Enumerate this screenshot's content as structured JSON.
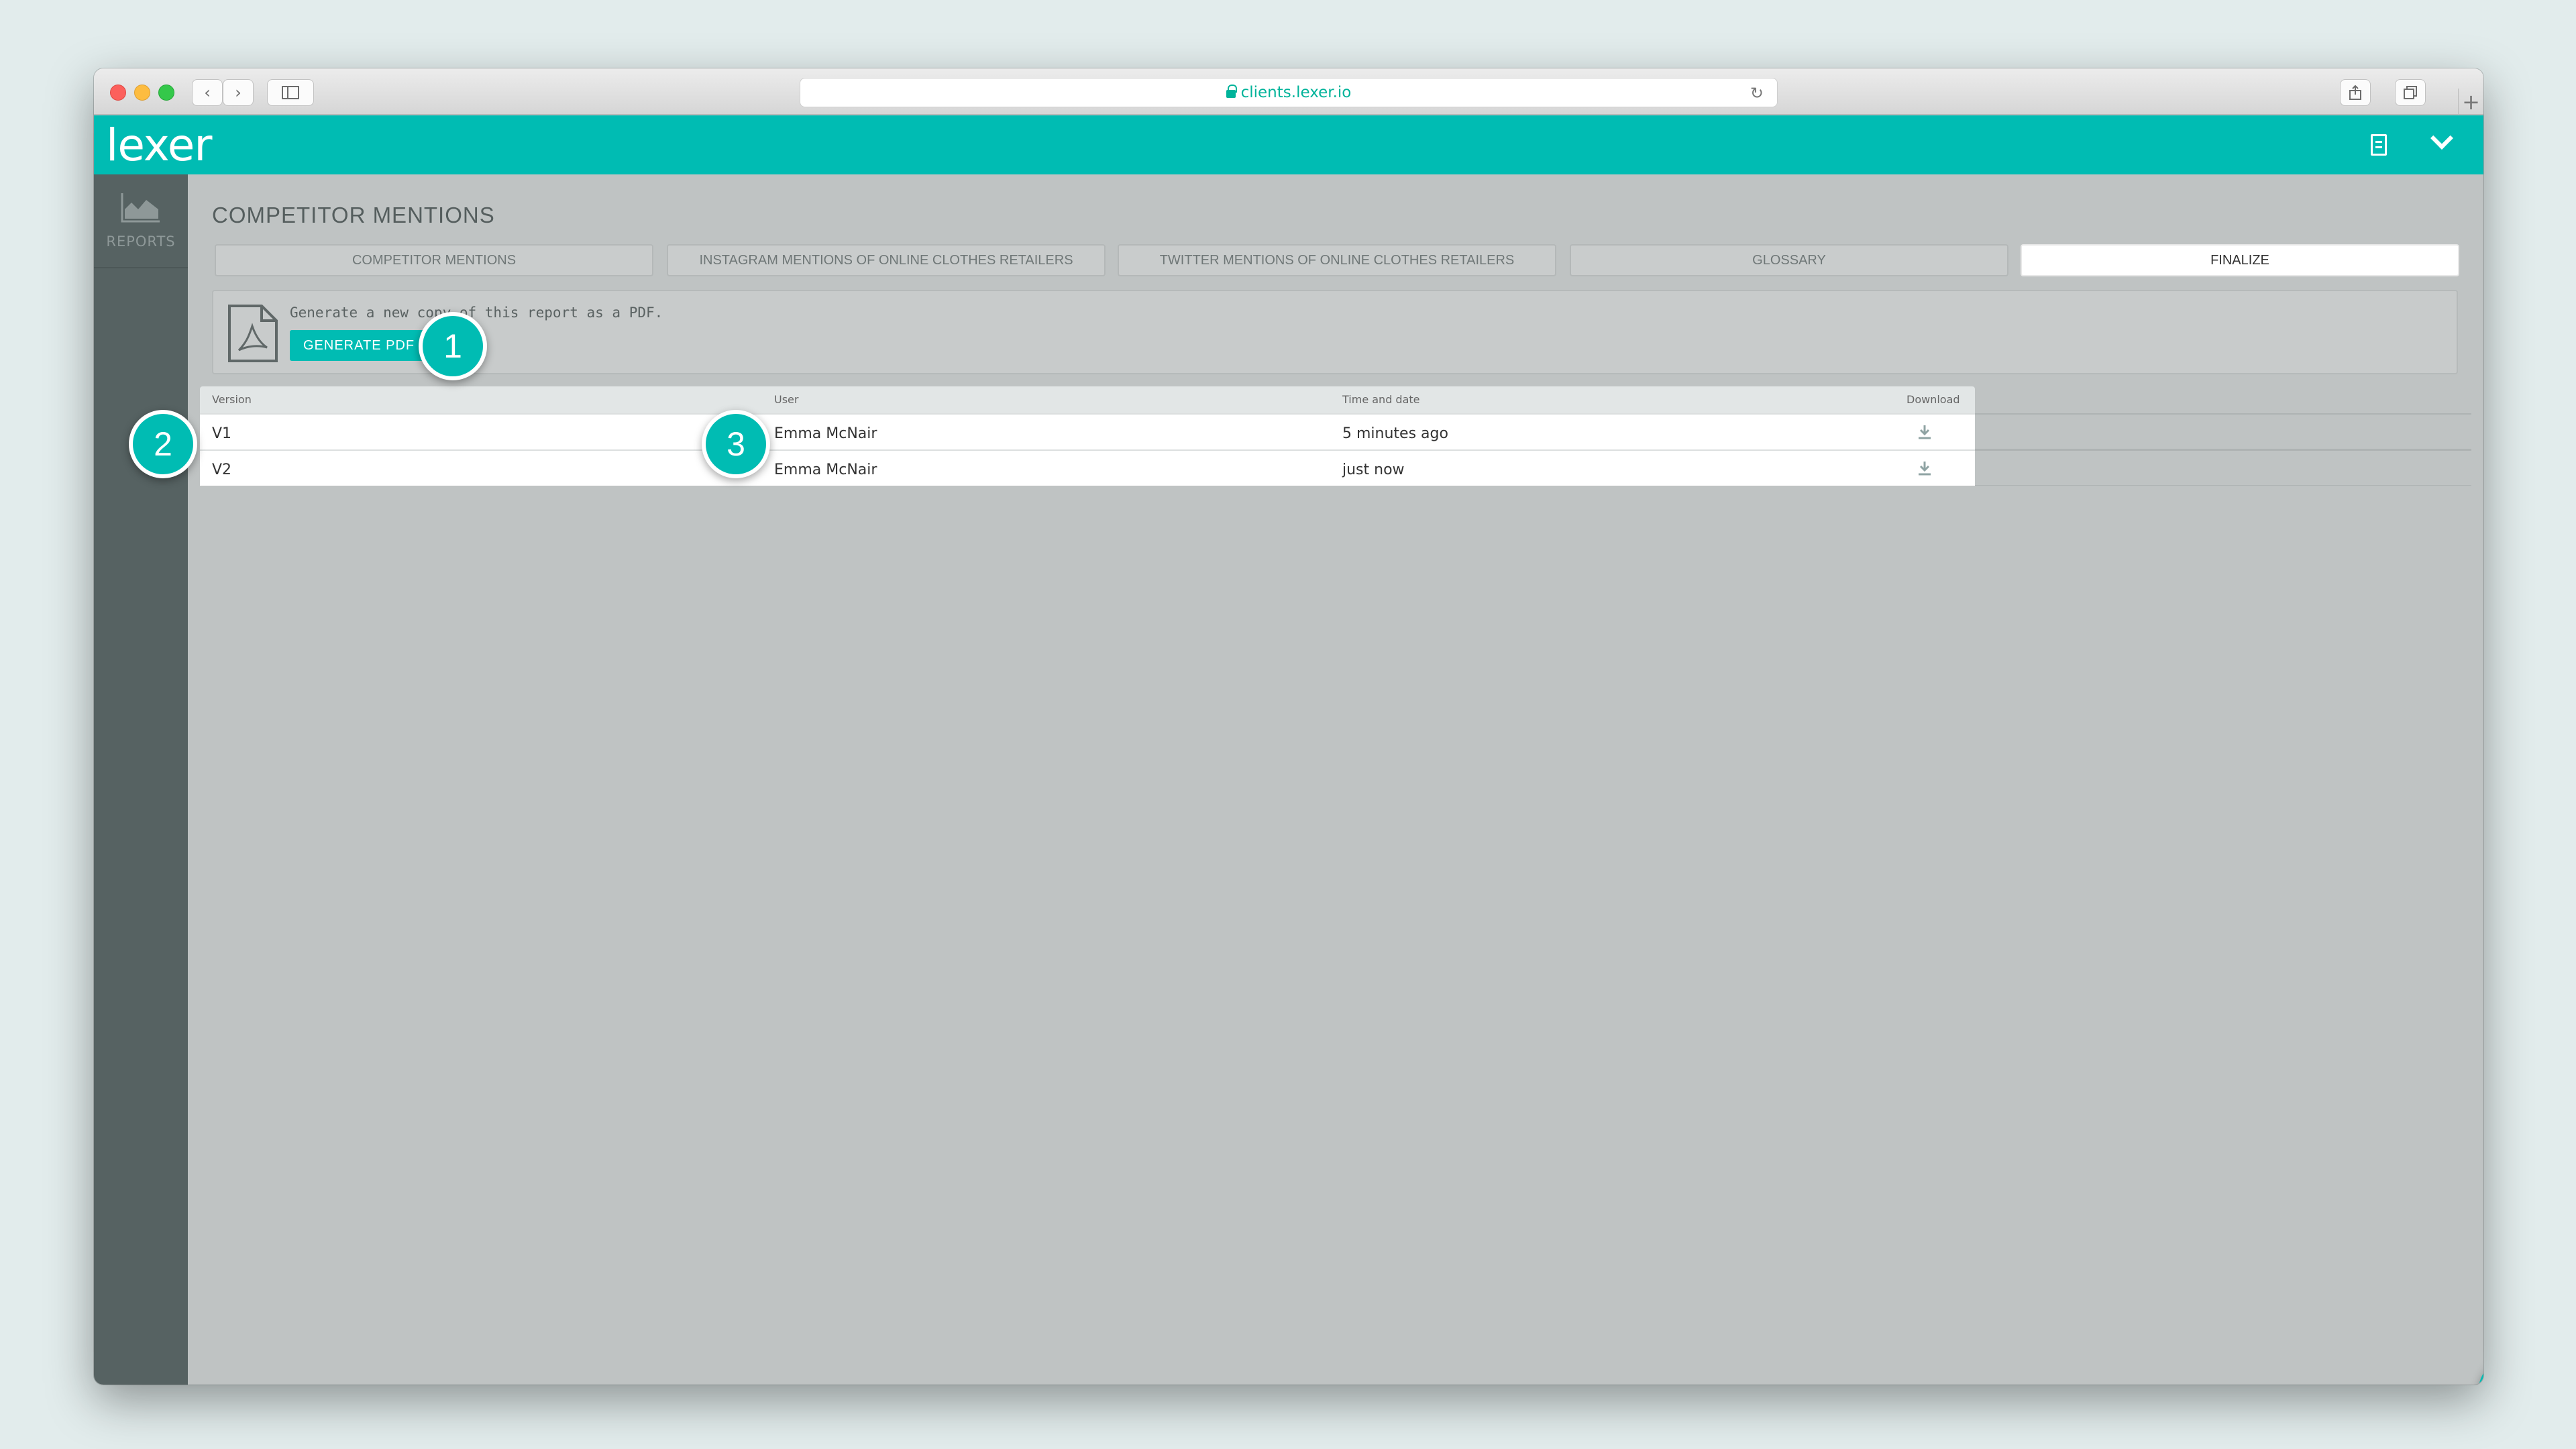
{
  "browser": {
    "url": "clients.lexer.io"
  },
  "app": {
    "logo": "lexer"
  },
  "sidebar": {
    "items": [
      {
        "label": "REPORTS",
        "icon": "area-chart-icon"
      }
    ]
  },
  "page": {
    "title": "COMPETITOR MENTIONS",
    "tabs": [
      {
        "label": "COMPETITOR MENTIONS",
        "active": false
      },
      {
        "label": "INSTAGRAM MENTIONS OF ONLINE CLOTHES RETAILERS",
        "active": false
      },
      {
        "label": "TWITTER MENTIONS OF ONLINE CLOTHES RETAILERS",
        "active": false
      },
      {
        "label": "GLOSSARY",
        "active": false
      },
      {
        "label": "FINALIZE",
        "active": true
      }
    ],
    "pdf": {
      "description": "Generate a new copy of this report as a PDF.",
      "button_label": "GENERATE PDF"
    },
    "table": {
      "columns": [
        "Version",
        "User",
        "Time and date",
        "Download"
      ],
      "rows": [
        {
          "version": "V1",
          "user": "Emma McNair",
          "time": "5 minutes ago"
        },
        {
          "version": "V2",
          "user": "Emma McNair",
          "time": "just now"
        }
      ]
    }
  },
  "callouts": [
    "1",
    "2",
    "3"
  ],
  "colors": {
    "brand": "#00bcb3",
    "sidebar": "#566262",
    "canvas": "#bfc3c3"
  }
}
